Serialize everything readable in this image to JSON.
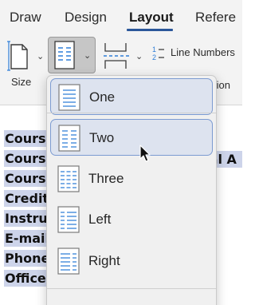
{
  "tabs": [
    {
      "label": "Draw"
    },
    {
      "label": "Design"
    },
    {
      "label": "Layout"
    },
    {
      "label": "Refere"
    }
  ],
  "ribbon": {
    "size_label": "Size",
    "line_numbers_label": "Line Numbers",
    "partial_label": "tion"
  },
  "document": {
    "lines": [
      "Course",
      "Course",
      "Course",
      "Credit",
      "Instruc",
      "E-mail:",
      "Phone",
      "Office"
    ],
    "fragment": "tal A"
  },
  "columns_menu": {
    "items": [
      {
        "label": "One",
        "icon": "columns-one-icon",
        "state": "selected"
      },
      {
        "label": "Two",
        "icon": "columns-two-icon",
        "state": "hovered"
      },
      {
        "label": "Three",
        "icon": "columns-three-icon",
        "state": "normal"
      },
      {
        "label": "Left",
        "icon": "columns-left-icon",
        "state": "normal"
      },
      {
        "label": "Right",
        "icon": "columns-right-icon",
        "state": "normal"
      }
    ]
  },
  "colors": {
    "accent": "#2b579a",
    "selection_highlight": "#cdd4ea",
    "menu_item_highlight": "#dde3ef",
    "menu_item_border": "#7c9bd1",
    "icon_blue": "#2f7ed8"
  }
}
